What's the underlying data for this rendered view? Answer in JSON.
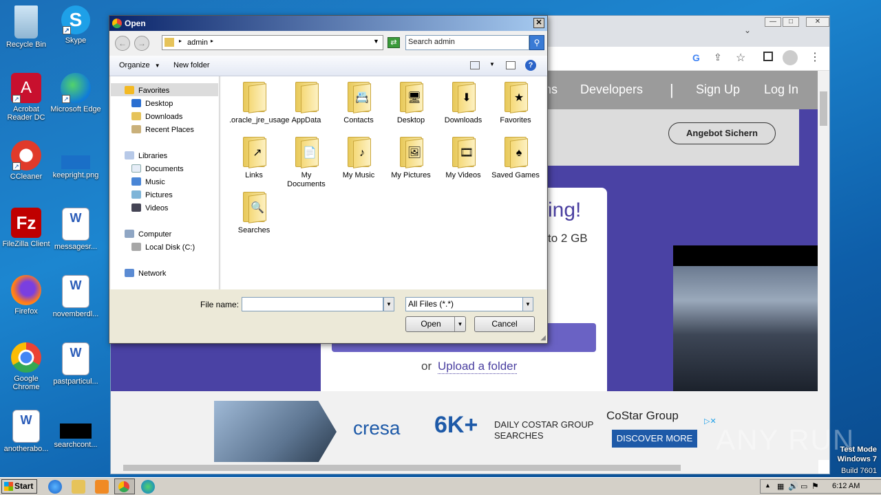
{
  "desktop": {
    "icons": [
      {
        "label": "Recycle Bin"
      },
      {
        "label": "Skype"
      },
      {
        "label": "Acrobat Reader DC"
      },
      {
        "label": "Microsoft Edge"
      },
      {
        "label": "CCleaner"
      },
      {
        "label": "keepright.png"
      },
      {
        "label": "FileZilla Client"
      },
      {
        "label": "messagesr..."
      },
      {
        "label": "Firefox"
      },
      {
        "label": "novemberdl..."
      },
      {
        "label": "Google Chrome"
      },
      {
        "label": "pastparticul..."
      },
      {
        "label": "anotherabo..."
      },
      {
        "label": "searchcont..."
      }
    ]
  },
  "browser": {
    "nav": {
      "ons_fragment": "ns",
      "developers": "Developers",
      "separator": "|",
      "sign_up": "Sign Up",
      "log_in": "Log In"
    },
    "angebot_button": "Angebot Sichern",
    "card": {
      "heading_fragment": "ring!",
      "sub_fragment": "to 2 GB",
      "or_text": "or",
      "upload_folder_link": "Upload a folder"
    },
    "ad": {
      "brand": "cresa",
      "big_number": "6K+",
      "line1": "DAILY COSTAR GROUP",
      "line2": "SEARCHES",
      "costar": "CoStar Group",
      "cta": "DISCOVER MORE"
    }
  },
  "dialog": {
    "title": "Open",
    "breadcrumb": "admin",
    "search_placeholder": "Search admin",
    "organize": "Organize",
    "new_folder": "New folder",
    "nav": {
      "favorites": "Favorites",
      "desktop": "Desktop",
      "downloads": "Downloads",
      "recent_places": "Recent Places",
      "libraries": "Libraries",
      "documents": "Documents",
      "music": "Music",
      "pictures": "Pictures",
      "videos": "Videos",
      "computer": "Computer",
      "local_disk": "Local Disk (C:)",
      "network": "Network"
    },
    "folders": [
      {
        "label": ".oracle_jre_usage",
        "emblem": ""
      },
      {
        "label": "AppData",
        "emblem": ""
      },
      {
        "label": "Contacts",
        "emblem": "📇"
      },
      {
        "label": "Desktop",
        "emblem": "🖥"
      },
      {
        "label": "Downloads",
        "emblem": "⬇"
      },
      {
        "label": "Favorites",
        "emblem": "★"
      },
      {
        "label": "Links",
        "emblem": "↗"
      },
      {
        "label": "My Documents",
        "emblem": "📄"
      },
      {
        "label": "My Music",
        "emblem": "♪"
      },
      {
        "label": "My Pictures",
        "emblem": "🖼"
      },
      {
        "label": "My Videos",
        "emblem": "🎞"
      },
      {
        "label": "Saved Games",
        "emblem": "♠"
      },
      {
        "label": "Searches",
        "emblem": "🔍"
      }
    ],
    "file_name_label": "File name:",
    "file_name_value": "",
    "file_type": "All Files (*.*)",
    "open_button": "Open",
    "cancel_button": "Cancel"
  },
  "taskbar": {
    "start": "Start",
    "clock": "6:12 AM"
  },
  "watermark": {
    "line1": "Test Mode",
    "line2": "Windows 7",
    "line3": "Build 7601",
    "logo": "ANY RUN"
  }
}
